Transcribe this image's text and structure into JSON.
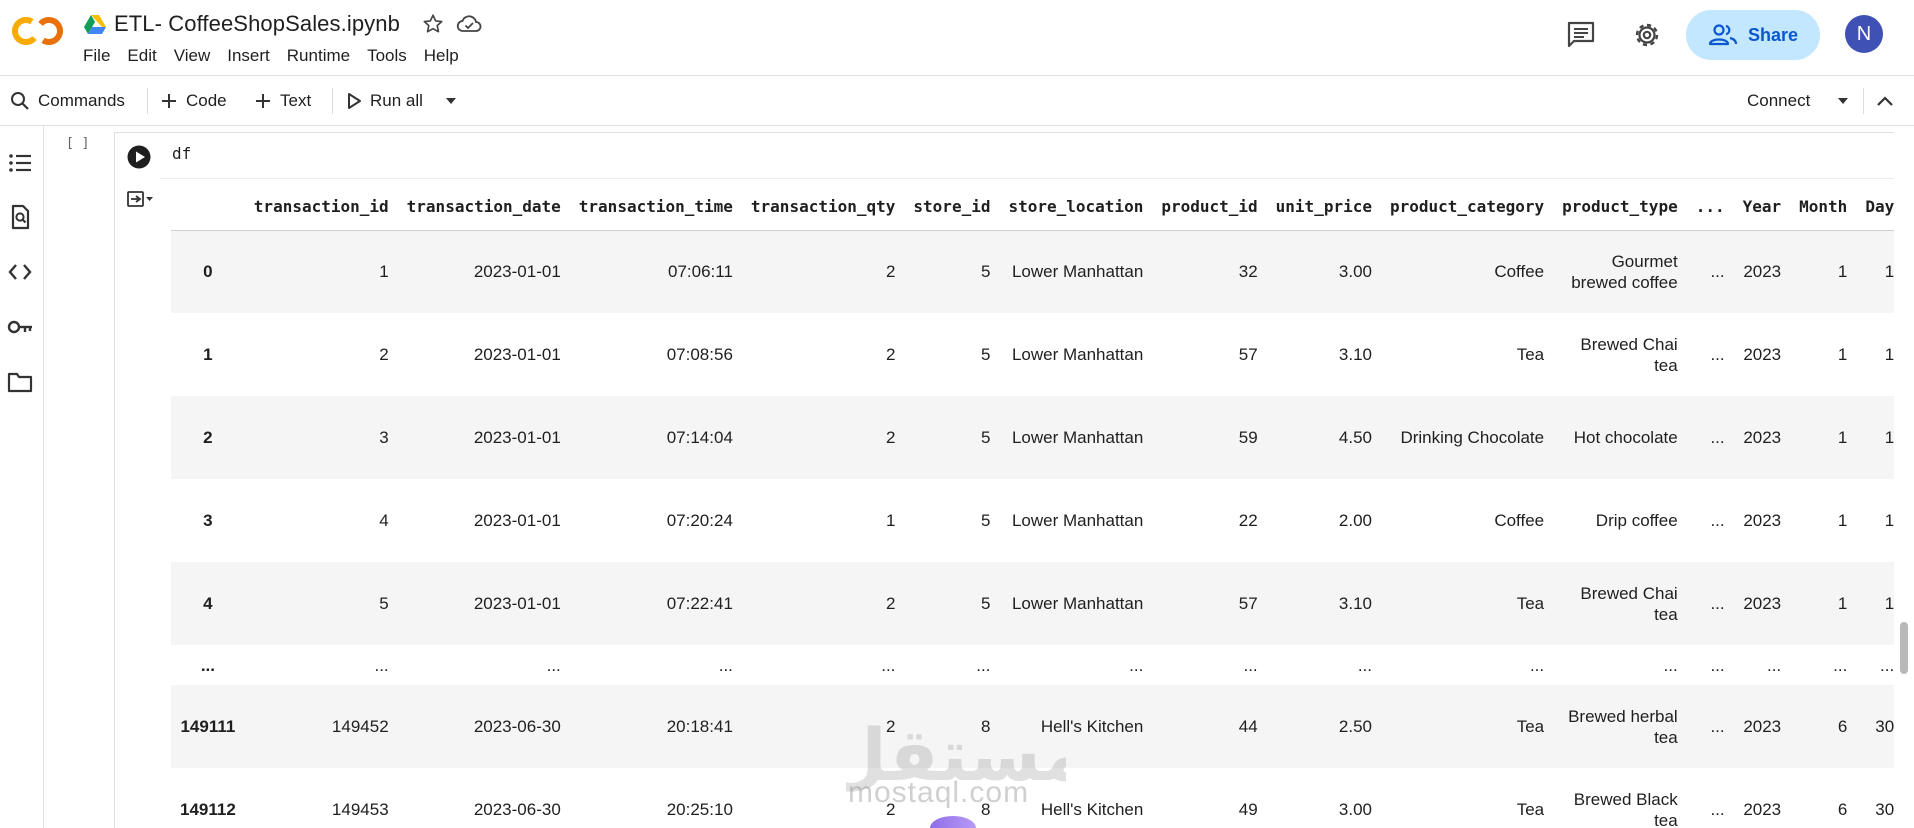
{
  "header": {
    "file_title": "ETL- CoffeeShopSales.ipynb",
    "menu": [
      "File",
      "Edit",
      "View",
      "Insert",
      "Runtime",
      "Tools",
      "Help"
    ],
    "share_label": "Share",
    "avatar_initial": "N",
    "logo_text": "CO"
  },
  "toolbar": {
    "commands_label": "Commands",
    "code_label": "Code",
    "text_label": "Text",
    "run_all_label": "Run all",
    "connect_label": "Connect"
  },
  "cell": {
    "execution_count": "[ ]",
    "code": "df"
  },
  "dataframe": {
    "columns": [
      "",
      "transaction_id",
      "transaction_date",
      "transaction_time",
      "transaction_qty",
      "store_id",
      "store_location",
      "product_id",
      "unit_price",
      "product_category",
      "product_type",
      "...",
      "Year",
      "Month",
      "Day"
    ],
    "rows": [
      [
        "0",
        "1",
        "2023-01-01",
        "07:06:11",
        "2",
        "5",
        "Lower Manhattan",
        "32",
        "3.00",
        "Coffee",
        "Gourmet brewed coffee",
        "...",
        "2023",
        "1",
        "1"
      ],
      [
        "1",
        "2",
        "2023-01-01",
        "07:08:56",
        "2",
        "5",
        "Lower Manhattan",
        "57",
        "3.10",
        "Tea",
        "Brewed Chai tea",
        "...",
        "2023",
        "1",
        "1"
      ],
      [
        "2",
        "3",
        "2023-01-01",
        "07:14:04",
        "2",
        "5",
        "Lower Manhattan",
        "59",
        "4.50",
        "Drinking Chocolate",
        "Hot chocolate",
        "...",
        "2023",
        "1",
        "1"
      ],
      [
        "3",
        "4",
        "2023-01-01",
        "07:20:24",
        "1",
        "5",
        "Lower Manhattan",
        "22",
        "2.00",
        "Coffee",
        "Drip coffee",
        "...",
        "2023",
        "1",
        "1"
      ],
      [
        "4",
        "5",
        "2023-01-01",
        "07:22:41",
        "2",
        "5",
        "Lower Manhattan",
        "57",
        "3.10",
        "Tea",
        "Brewed Chai tea",
        "...",
        "2023",
        "1",
        "1"
      ],
      [
        "...",
        "...",
        "...",
        "...",
        "...",
        "...",
        "...",
        "...",
        "...",
        "...",
        "...",
        "...",
        "...",
        "...",
        "..."
      ],
      [
        "149111",
        "149452",
        "2023-06-30",
        "20:18:41",
        "2",
        "8",
        "Hell's Kitchen",
        "44",
        "2.50",
        "Tea",
        "Brewed herbal tea",
        "...",
        "2023",
        "6",
        "30"
      ],
      [
        "149112",
        "149453",
        "2023-06-30",
        "20:25:10",
        "2",
        "8",
        "Hell's Kitchen",
        "49",
        "3.00",
        "Tea",
        "Brewed Black tea",
        "...",
        "2023",
        "6",
        "30"
      ]
    ]
  },
  "watermark": {
    "arabic": "مستقل",
    "domain": "mostaql.com"
  },
  "colors": {
    "share_bg": "#c2e7ff",
    "share_text": "#0b57d0",
    "avatar_bg": "#3f51b5",
    "logo_orange": "#f9ab00",
    "logo_dark_orange": "#e8710a"
  }
}
